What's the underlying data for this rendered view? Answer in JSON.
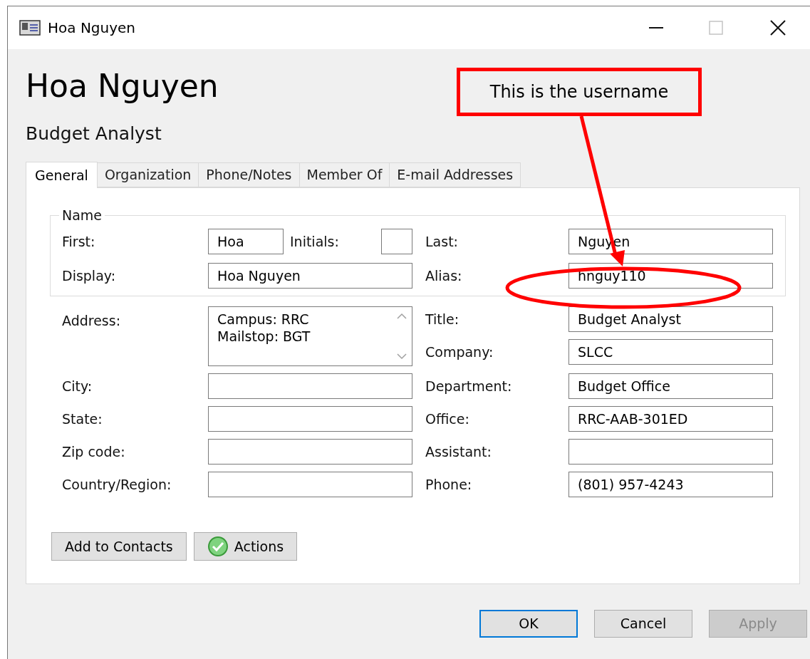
{
  "window": {
    "title": "Hoa Nguyen"
  },
  "header": {
    "name": "Hoa Nguyen",
    "job_title": "Budget Analyst"
  },
  "tabs": [
    {
      "label": "General",
      "selected": true
    },
    {
      "label": "Organization",
      "selected": false
    },
    {
      "label": "Phone/Notes",
      "selected": false
    },
    {
      "label": "Member Of",
      "selected": false
    },
    {
      "label": "E-mail Addresses",
      "selected": false
    }
  ],
  "name_group": {
    "legend": "Name",
    "first": {
      "label": "First:",
      "value": "Hoa"
    },
    "initials": {
      "label": "Initials:"
    },
    "last": {
      "label": "Last:",
      "value": "Nguyen"
    },
    "display": {
      "label": "Display:",
      "value": "Hoa Nguyen"
    },
    "alias": {
      "label": "Alias:",
      "value": "hnguy110"
    }
  },
  "address": {
    "label": "Address:",
    "lines": [
      "Campus: RRC",
      "Mailstop: BGT"
    ]
  },
  "left_fields": [
    {
      "label": "City:"
    },
    {
      "label": "State:"
    },
    {
      "label": "Zip code:"
    },
    {
      "label": "Country/Region:"
    }
  ],
  "right_fields": [
    {
      "label": "Title:",
      "value": "Budget Analyst"
    },
    {
      "label": "Company:",
      "value": "SLCC"
    },
    {
      "label": "Department:",
      "value": "Budget Office"
    },
    {
      "label": "Office:",
      "value": "RRC-AAB-301ED"
    },
    {
      "label": "Assistant:"
    },
    {
      "label": "Phone:",
      "value": "(801) 957-4243"
    }
  ],
  "panel_buttons": [
    {
      "label": "Add to Contacts",
      "kind": "plain"
    },
    {
      "label": "Actions",
      "kind": "actions"
    }
  ],
  "dialog_buttons": [
    {
      "label": "OK",
      "default": true,
      "disabled": false
    },
    {
      "label": "Cancel",
      "default": false,
      "disabled": false
    },
    {
      "label": "Apply",
      "default": false,
      "disabled": true
    }
  ],
  "annotation": {
    "callout": "This is the username"
  }
}
